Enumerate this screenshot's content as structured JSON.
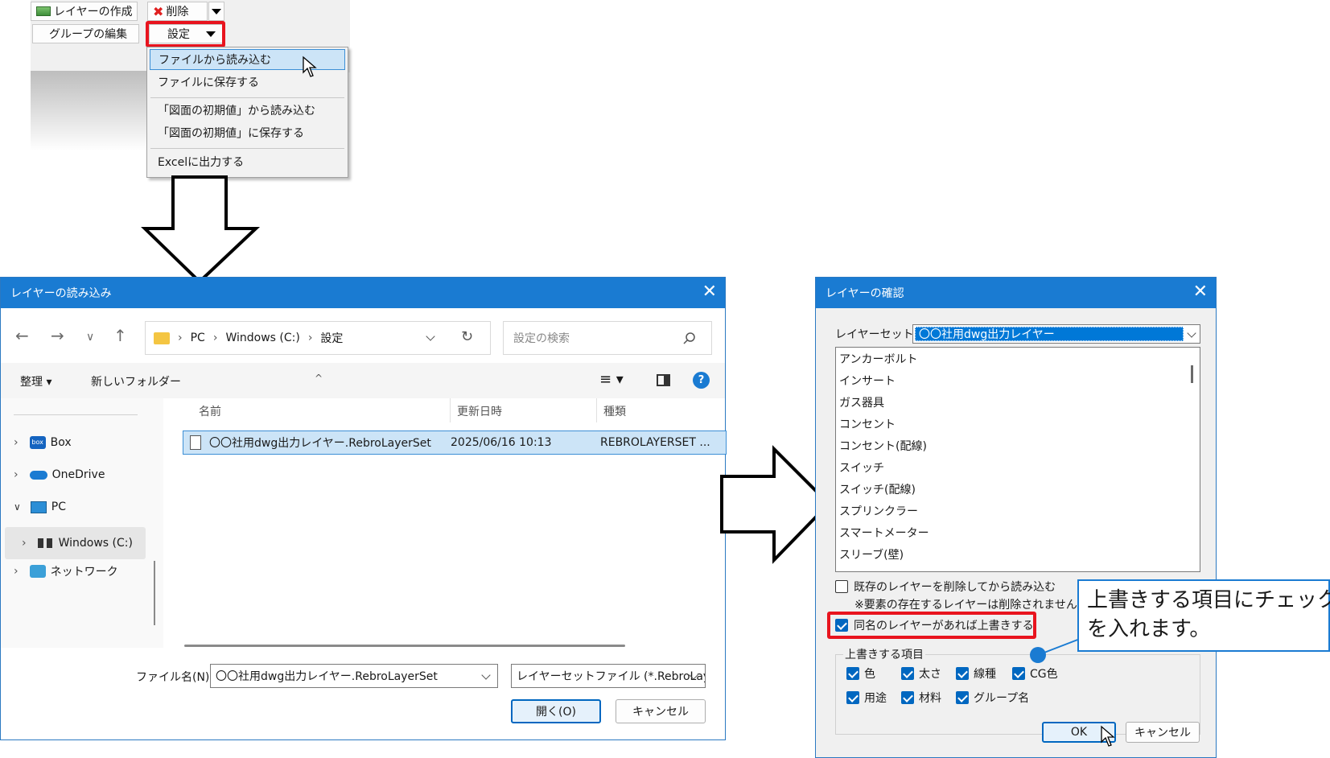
{
  "top_panel": {
    "create_layer_label": "レイヤーの作成",
    "delete_label": "削除",
    "edit_group_label": "グループの編集",
    "settings_label": "設定",
    "menu": [
      "ファイルから読み込む",
      "ファイルに保存する",
      "「図面の初期値」から読み込む",
      "「図面の初期値」に保存する",
      "Excelに出力する"
    ]
  },
  "open_dialog": {
    "title": "レイヤーの読み込み",
    "breadcrumb": [
      "PC",
      "Windows (C:)",
      "設定"
    ],
    "search_placeholder": "設定の検索",
    "organize_label": "整理",
    "new_folder_label": "新しいフォルダー",
    "sidebar": [
      "Box",
      "OneDrive",
      "PC",
      "Windows (C:)",
      "ネットワーク"
    ],
    "columns": [
      "名前",
      "更新日時",
      "種類"
    ],
    "file": {
      "name": "〇〇社用dwg出力レイヤー.RebroLayerSet",
      "modified": "2025/06/16 10:13",
      "type": "REBROLAYERSET ..."
    },
    "filename_label": "ファイル名(N):",
    "filename_value": "〇〇社用dwg出力レイヤー.RebroLayerSet",
    "filetype_value": "レイヤーセットファイル (*.RebroLaye",
    "open_button": "開く(O)",
    "cancel_button": "キャンセル"
  },
  "confirm_dialog": {
    "title": "レイヤーの確認",
    "layer_set_label": "レイヤーセット",
    "layer_set_value": "〇〇社用dwg出力レイヤー",
    "layers": [
      "アンカーボルト",
      "インサート",
      "ガス器具",
      "コンセント",
      "コンセント(配線)",
      "スイッチ",
      "スイッチ(配線)",
      "スプリンクラー",
      "スマートメーター",
      "スリーブ(壁)"
    ],
    "delete_existing_label": "既存のレイヤーを削除してから読み込む",
    "delete_note": "※要素の存在するレイヤーは削除されません",
    "overwrite_label": "同名のレイヤーがあれば上書きする",
    "overwrite_group_label": "上書きする項目",
    "overwrite_items": [
      "色",
      "太さ",
      "線種",
      "CG色",
      "用途",
      "材料",
      "グループ名"
    ],
    "ok_button": "OK",
    "cancel_button": "キャンセル"
  },
  "callout": {
    "line1": "上書きする項目にチェック",
    "line2": "を入れます。"
  },
  "colors": {
    "accent": "#1a7bd2",
    "highlight": "#e8141e",
    "selection": "#cce4f7"
  }
}
